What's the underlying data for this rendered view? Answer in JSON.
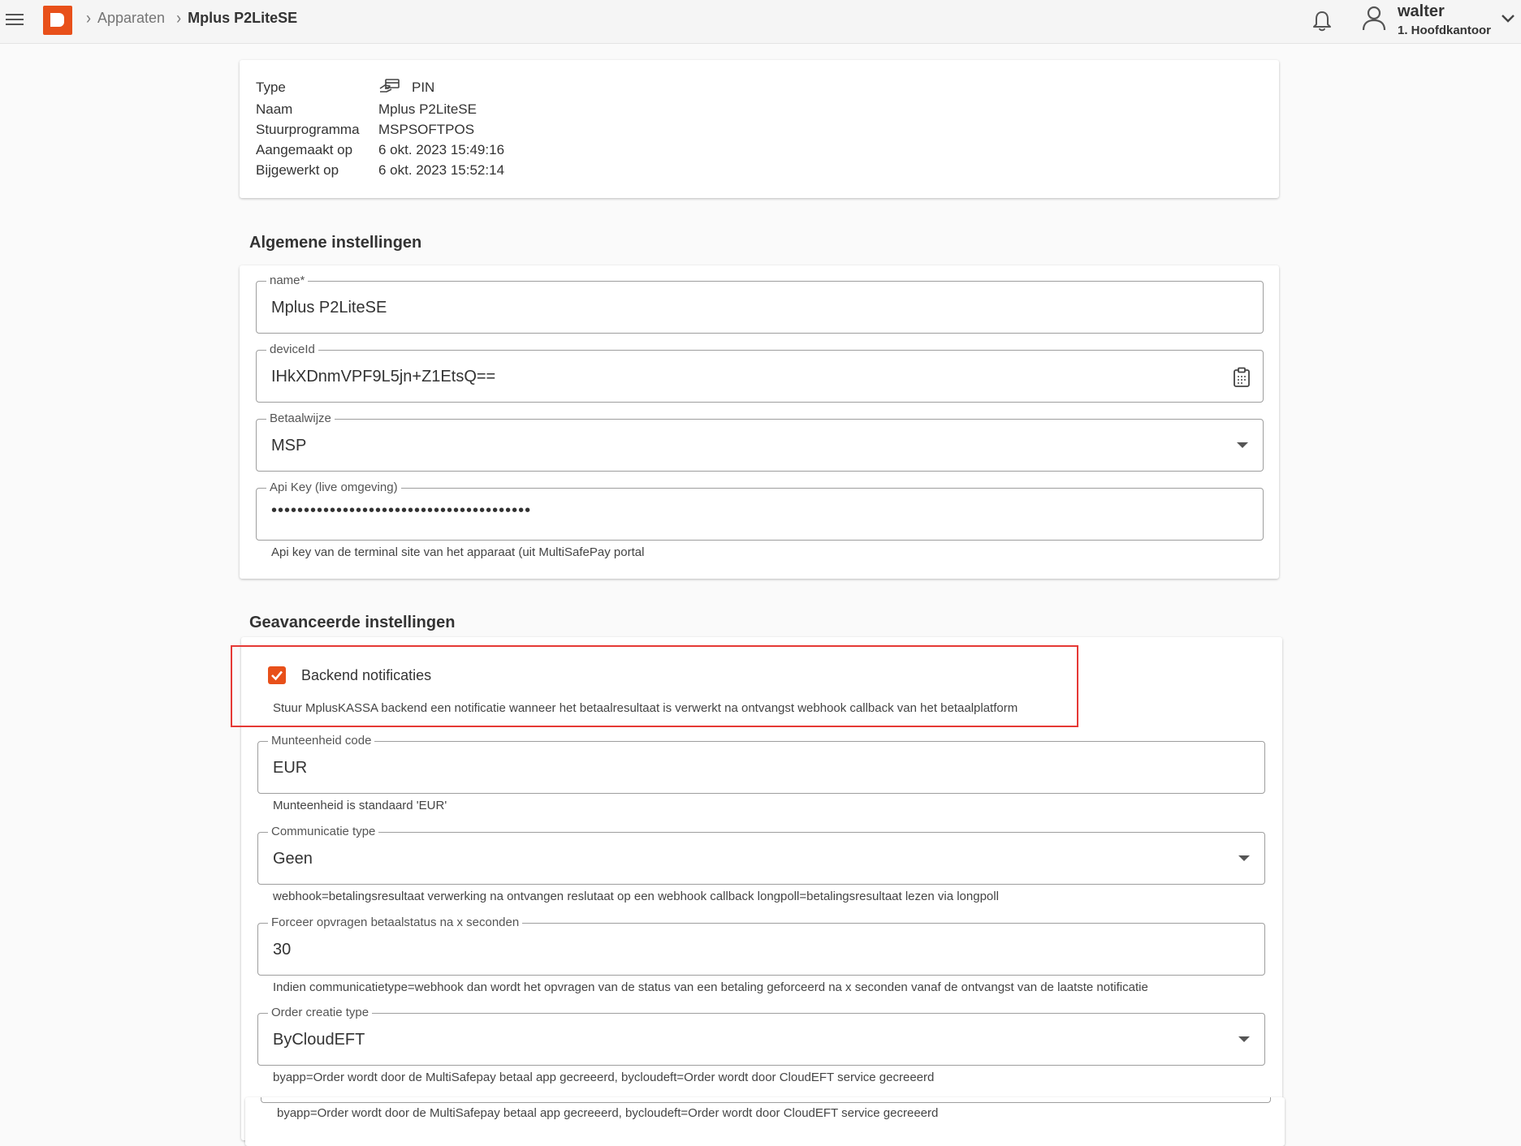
{
  "breadcrumb": {
    "parent": "Apparaten",
    "current": "Mplus P2LiteSE"
  },
  "user": {
    "name": "walter",
    "branch": "1. Hoofdkantoor"
  },
  "info": {
    "rows": [
      {
        "label": "Type",
        "value": "PIN"
      },
      {
        "label": "Naam",
        "value": "Mplus P2LiteSE"
      },
      {
        "label": "Stuurprogramma",
        "value": "MSPSOFTPOS"
      },
      {
        "label": "Aangemaakt op",
        "value": "6 okt. 2023 15:49:16"
      },
      {
        "label": "Bijgewerkt op",
        "value": "6 okt. 2023 15:52:14"
      }
    ]
  },
  "general": {
    "title": "Algemene instellingen",
    "name": {
      "label": "name*",
      "value": "Mplus P2LiteSE"
    },
    "deviceId": {
      "label": "deviceId",
      "value": "IHkXDnmVPF9L5jn+Z1EtsQ=="
    },
    "paymentMethod": {
      "label": "Betaalwijze",
      "value": "MSP"
    },
    "apiKey": {
      "label": "Api Key (live omgeving)",
      "value": "••••••••••••••••••••••••••••••••••••••••",
      "hint": "Api key van de terminal site van het apparaat (uit MultiSafePay portal"
    }
  },
  "advanced": {
    "title": "Geavanceerde instellingen",
    "backendNotifications": {
      "label": "Backend notificaties",
      "checked": true,
      "hint": "Stuur MplusKASSA backend een notificatie wanneer het betaalresultaat is verwerkt na ontvangst webhook callback van het betaalplatform"
    },
    "currency": {
      "label": "Munteenheid code",
      "value": "EUR",
      "hint": "Munteenheid is standaard 'EUR'"
    },
    "commType": {
      "label": "Communicatie type",
      "value": "Geen",
      "hint": "webhook=betalingsresultaat verwerking na ontvangen reslutaat op een webhook callback longpoll=betalingsresultaat lezen via longpoll"
    },
    "forceStatus": {
      "label": "Forceer opvragen betaalstatus na x seconden",
      "value": "30",
      "hint": "Indien communicatietype=webhook dan wordt het opvragen van de status van een betaling geforceerd na x seconden vanaf de ontvangst van de laatste notificatie"
    },
    "orderCreation": {
      "label": "Order creatie type",
      "value": "ByCloudEFT",
      "hint": "byapp=Order wordt door de MultiSafepay betaal app gecreeerd, bycloudeft=Order wordt door CloudEFT service gecreeerd",
      "hint2": "byapp=Order wordt door de MultiSafepay betaal app gecreeerd, bycloudeft=Order wordt door CloudEFT service gecreeerd"
    }
  },
  "colors": {
    "accent": "#e8501a",
    "highlight": "#e53935"
  }
}
